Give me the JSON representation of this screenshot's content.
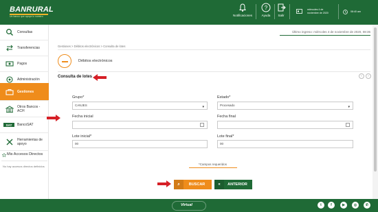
{
  "header": {
    "logo_text": "BANRURAL",
    "logo_tagline": "Un banco que apoya lo nuestro",
    "items": [
      {
        "label": "Notificaciones",
        "icon": "bell-icon"
      },
      {
        "label": "Ayuda",
        "icon": "help-icon"
      },
      {
        "label": "Salir",
        "icon": "exit-icon"
      }
    ],
    "session_date_1": "miércoles 4 de",
    "session_date_2": "noviembre de 2020",
    "session_time": "08:40 am"
  },
  "sidebar": {
    "items": [
      {
        "label": "Consultas",
        "icon": "search-icon"
      },
      {
        "label": "Transferencias",
        "icon": "transfer-icon"
      },
      {
        "label": "Pagos",
        "icon": "payments-icon"
      },
      {
        "label": "Administración",
        "icon": "admin-icon"
      },
      {
        "label": "Gestiones",
        "icon": "gestiones-icon",
        "active": true
      },
      {
        "label": "Otros Bancos - ACH",
        "icon": "ach-icon"
      },
      {
        "label": "BancoSAT",
        "icon": "sat-icon"
      },
      {
        "label": "Herramientas de apoyo",
        "icon": "tools-icon"
      }
    ],
    "accesos_title": "Mis Accesos Directos",
    "accesos_empty": "No hay accesos directos definidos"
  },
  "main": {
    "last_login": "Último ingreso: miércoles 4 de noviembre de 2020, 08:35",
    "breadcrumb": "Gestiones > Débitos electrónicos > Consulta de lotes",
    "module_title": "Débitos electrónicos",
    "section_title": "Consulta de lotes",
    "fields": {
      "grupo_label": "Grupo*",
      "grupo_value": "CANJES",
      "estado_label": "Estado*",
      "estado_value": "Procesado",
      "fecha_inicial_label": "Fecha inicial",
      "fecha_final_label": "Fecha final",
      "lote_inicial_label": "Lote inicial*",
      "lote_inicial_value": "00",
      "lote_final_label": "Lote final*",
      "lote_final_value": "00"
    },
    "required_note": "*Campos requeridos",
    "buttons": {
      "search": "BUSCAR",
      "back": "ANTERIOR"
    }
  },
  "footer": {
    "logo_text": "Virtual",
    "social": [
      "twitter",
      "facebook",
      "youtube",
      "instagram",
      "whatsapp"
    ]
  },
  "colors": {
    "brand_green": "#1f6a36",
    "accent_orange": "#ef8c1b",
    "arrow_red": "#d61f26"
  }
}
